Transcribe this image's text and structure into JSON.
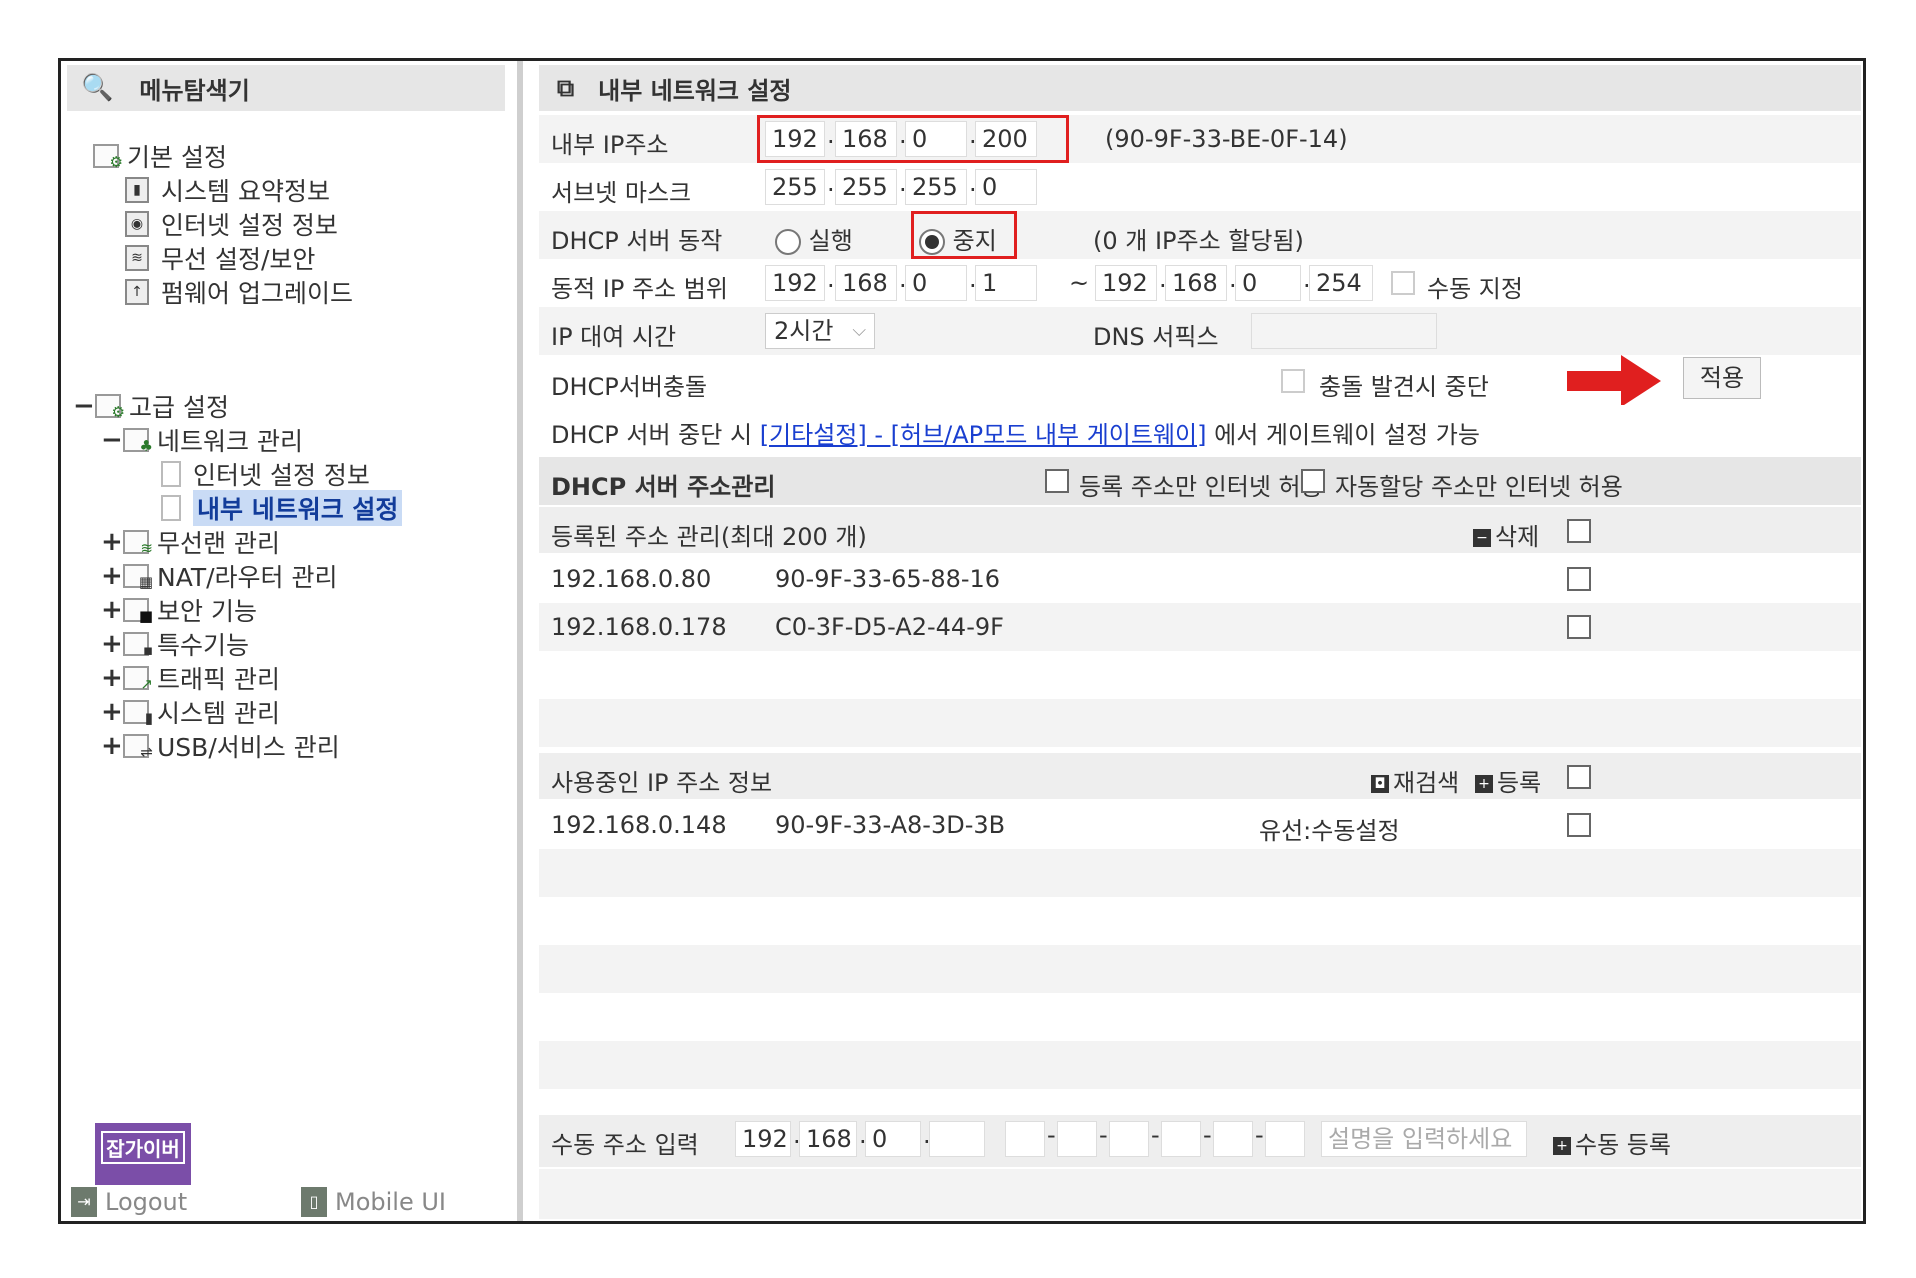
{
  "left": {
    "title": "메뉴탐색기",
    "tree": [
      {
        "label": "기본 설정",
        "expander": ""
      },
      {
        "label": "시스템 요약정보"
      },
      {
        "label": "인터넷 설정 정보"
      },
      {
        "label": "무선 설정/보안"
      },
      {
        "label": "펌웨어 업그레이드"
      },
      {
        "label": "고급 설정",
        "expander": "−"
      },
      {
        "label": "네트워크 관리",
        "expander": "−"
      },
      {
        "label": "인터넷 설정 정보"
      },
      {
        "label": "내부 네트워크 설정"
      },
      {
        "label": "무선랜 관리",
        "expander": "+"
      },
      {
        "label": "NAT/라우터 관리",
        "expander": "+"
      },
      {
        "label": "보안 기능",
        "expander": "+"
      },
      {
        "label": "특수기능",
        "expander": "+"
      },
      {
        "label": "트래픽 관리",
        "expander": "+"
      },
      {
        "label": "시스템 관리",
        "expander": "+"
      },
      {
        "label": "USB/서비스 관리",
        "expander": "+"
      }
    ],
    "logo_text": "잡가이버",
    "logout": "Logout",
    "mobile": "Mobile UI"
  },
  "right": {
    "title": "내부 네트워크 설정",
    "ip_label": "내부 IP주소",
    "ip": [
      "192",
      "168",
      "0",
      "200"
    ],
    "mac": "(90-9F-33-BE-0F-14)",
    "subnet_label": "서브넷 마스크",
    "subnet": [
      "255",
      "255",
      "255",
      "0"
    ],
    "dhcp_label": "DHCP 서버 동작",
    "dhcp_run": "실행",
    "dhcp_stop": "중지",
    "dhcp_note": "(0 개 IP주소 할당됨)",
    "range_label": "동적 IP 주소 범위",
    "range_start": [
      "192",
      "168",
      "0",
      "1"
    ],
    "range_sep": "~",
    "range_end": [
      "192",
      "168",
      "0",
      "254"
    ],
    "manual_label": "수동 지정",
    "lease_label": "IP 대여 시간",
    "lease_value": "2시간",
    "dns_label": "DNS 서픽스",
    "conflict_label": "DHCP서버충돌",
    "conflict_stop": "충돌 발견시 중단",
    "apply": "적용",
    "note_prefix": "DHCP 서버 중단 시",
    "note_link": "[기타설정] - [허브/AP모드 내부 게이트웨이]",
    "note_suffix": "에서 게이트웨이 설정 가능",
    "addr_mgmt_title": "DHCP 서버 주소관리",
    "only_registered": "등록 주소만 인터넷 허용",
    "only_auto": "자동할당 주소만 인터넷 허용",
    "registered_title": "등록된 주소 관리(최대 200 개)",
    "delete": "삭제",
    "registered": [
      {
        "ip": "192.168.0.80",
        "mac": "90-9F-33-65-88-16"
      },
      {
        "ip": "192.168.0.178",
        "mac": "C0-3F-D5-A2-44-9F"
      }
    ],
    "inuse_title": "사용중인 IP 주소 정보",
    "rescan": "재검색",
    "register": "등록",
    "inuse": [
      {
        "ip": "192.168.0.148",
        "mac": "90-9F-33-A8-3D-3B",
        "type": "유선:수동설정"
      }
    ],
    "manual_input_label": "수동 주소 입력",
    "manual_ip": [
      "192",
      "168",
      "0",
      ""
    ],
    "desc_placeholder": "설명을 입력하세요",
    "manual_register": "수동 등록",
    "accent_red": "#e01f1f",
    "link_color": "#1a3fd0"
  }
}
